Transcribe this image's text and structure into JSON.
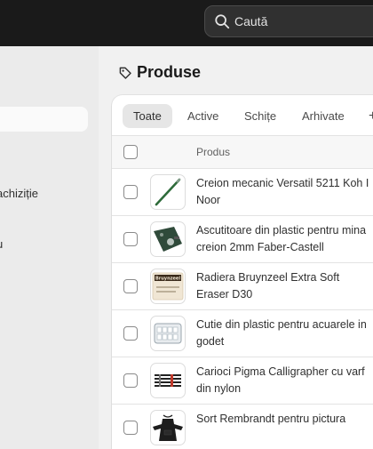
{
  "search": {
    "placeholder": "Caută"
  },
  "sidebar": {
    "items": [
      {
        "label": "achiziție"
      },
      {
        "label": "u"
      }
    ]
  },
  "page": {
    "title": "Produse"
  },
  "tabs": [
    {
      "label": "Toate",
      "selected": true
    },
    {
      "label": "Active"
    },
    {
      "label": "Schițe"
    },
    {
      "label": "Arhivate"
    }
  ],
  "table": {
    "column_product": "Produs",
    "rows": [
      {
        "name": "Creion mecanic Versatil 5211 Koh I Noor",
        "image": "green-pencil-image"
      },
      {
        "name": "Ascutitoare din plastic pentru mina creion 2mm Faber-Castell",
        "image": "green-sharpener-image"
      },
      {
        "name": "Radiera Bruynzeel Extra Soft Eraser D30",
        "image": "eraser-image",
        "image_text": "Bruynzeel"
      },
      {
        "name": "Cutie din plastic pentru acuarele in godet",
        "image": "watercolor-box-image"
      },
      {
        "name": "Carioci Pigma Calligrapher cu varf din nylon",
        "image": "pens-image"
      },
      {
        "name": "Sort Rembrandt pentru pictura",
        "image": "apron-image"
      }
    ]
  },
  "colors": {
    "topbar": "#1a1a1a",
    "background": "#f1f1f1",
    "card": "#ffffff"
  }
}
